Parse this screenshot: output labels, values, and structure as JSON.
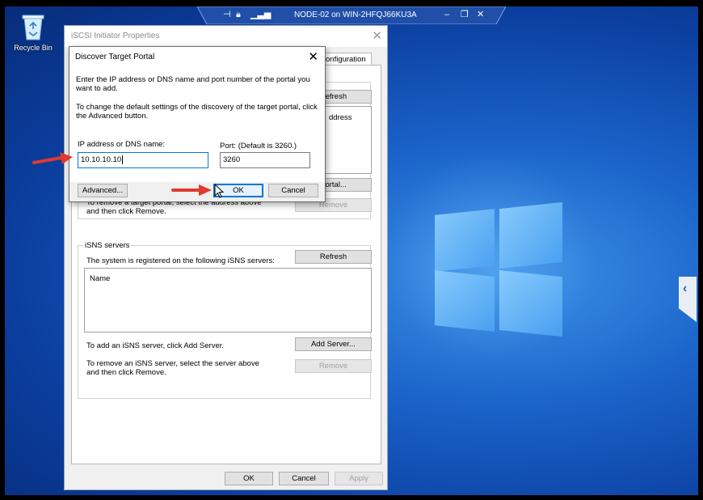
{
  "desktop": {
    "recycle_bin_label": "Recycle Bin"
  },
  "remote_bar": {
    "title": "NODE-02 on WIN-2HFQJ66KU3A",
    "icons": [
      "pin-icon",
      "lock-icon",
      "signal-icon",
      "minimize-icon",
      "restore-icon",
      "close-icon"
    ]
  },
  "main_dialog": {
    "title": "iSCSI Initiator Properties",
    "tab_visible_label": "onfiguration",
    "refresh_label": "Refresh",
    "list_header_fragment": "ddress",
    "discover_portal_label": "Portal...",
    "remove_text": "To remove a target portal, select the address above and then click Remove.",
    "remove_label": "Remove",
    "isns": {
      "legend": "iSNS servers",
      "registered_text": "The system is registered on the following iSNS servers:",
      "refresh_label": "Refresh",
      "column_name": "Name",
      "add_text": "To add an iSNS server, click Add Server.",
      "add_server_label": "Add Server...",
      "remove_text": "To remove an iSNS server, select the server above and then click Remove.",
      "remove_label": "Remove"
    },
    "ok_label": "OK",
    "cancel_label": "Cancel",
    "apply_label": "Apply"
  },
  "discover_dialog": {
    "title": "Discover Target Portal",
    "instructions": "Enter the IP address or DNS name and port number of the portal you want to add.",
    "advanced_hint": "To change the default settings of the discovery of the target portal, click the Advanced button.",
    "ip_label": "IP address or DNS name:",
    "ip_value": "10.10.10.10",
    "port_label": "Port: (Default is 3260.)",
    "port_value": "3260",
    "advanced_label": "Advanced...",
    "ok_label": "OK",
    "cancel_label": "Cancel"
  },
  "colors": {
    "desktop_blue": "#1a63c9",
    "focus_blue": "#0078d7",
    "annotation_red": "#e03a2f"
  }
}
